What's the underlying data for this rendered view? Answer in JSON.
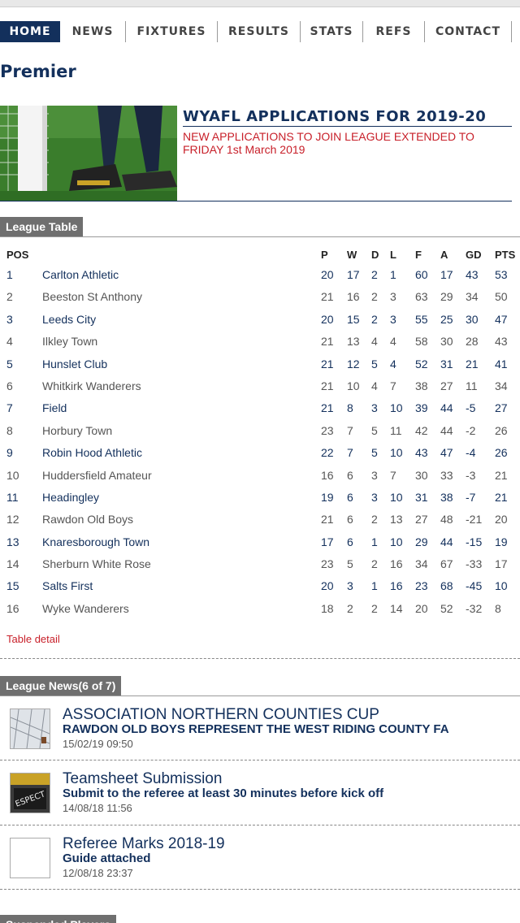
{
  "nav": {
    "items": [
      {
        "label": "HOME",
        "active": true
      },
      {
        "label": "NEWS"
      },
      {
        "label": "FIXTURES"
      },
      {
        "label": "RESULTS"
      },
      {
        "label": "STATS"
      },
      {
        "label": "REFS"
      },
      {
        "label": "CONTACT"
      }
    ]
  },
  "page_title": "Premier",
  "banner": {
    "title": "WYAFL APPLICATIONS FOR 2019-20",
    "subtitle": "NEW APPLICATIONS TO JOIN LEAGUE EXTENDED TO FRIDAY 1st March 2019"
  },
  "league_table": {
    "tab_label": "League Table",
    "headers": [
      "POS",
      "",
      "P",
      "W",
      "D",
      "L",
      "F",
      "A",
      "GD",
      "PTS"
    ],
    "rows": [
      [
        "1",
        "Carlton Athletic",
        "20",
        "17",
        "2",
        "1",
        "60",
        "17",
        "43",
        "53"
      ],
      [
        "2",
        "Beeston St Anthony",
        "21",
        "16",
        "2",
        "3",
        "63",
        "29",
        "34",
        "50"
      ],
      [
        "3",
        "Leeds City",
        "20",
        "15",
        "2",
        "3",
        "55",
        "25",
        "30",
        "47"
      ],
      [
        "4",
        "Ilkley Town",
        "21",
        "13",
        "4",
        "4",
        "58",
        "30",
        "28",
        "43"
      ],
      [
        "5",
        "Hunslet Club",
        "21",
        "12",
        "5",
        "4",
        "52",
        "31",
        "21",
        "41"
      ],
      [
        "6",
        "Whitkirk Wanderers",
        "21",
        "10",
        "4",
        "7",
        "38",
        "27",
        "11",
        "34"
      ],
      [
        "7",
        "Field",
        "21",
        "8",
        "3",
        "10",
        "39",
        "44",
        "-5",
        "27"
      ],
      [
        "8",
        "Horbury Town",
        "23",
        "7",
        "5",
        "11",
        "42",
        "44",
        "-2",
        "26"
      ],
      [
        "9",
        "Robin Hood Athletic",
        "22",
        "7",
        "5",
        "10",
        "43",
        "47",
        "-4",
        "26"
      ],
      [
        "10",
        "Huddersfield Amateur",
        "16",
        "6",
        "3",
        "7",
        "30",
        "33",
        "-3",
        "21"
      ],
      [
        "11",
        "Headingley",
        "19",
        "6",
        "3",
        "10",
        "31",
        "38",
        "-7",
        "21"
      ],
      [
        "12",
        "Rawdon Old Boys",
        "21",
        "6",
        "2",
        "13",
        "27",
        "48",
        "-21",
        "20"
      ],
      [
        "13",
        "Knaresborough Town",
        "17",
        "6",
        "1",
        "10",
        "29",
        "44",
        "-15",
        "19"
      ],
      [
        "14",
        "Sherburn White Rose",
        "23",
        "5",
        "2",
        "16",
        "34",
        "67",
        "-33",
        "17"
      ],
      [
        "15",
        "Salts First",
        "20",
        "3",
        "1",
        "16",
        "23",
        "68",
        "-45",
        "10"
      ],
      [
        "16",
        "Wyke Wanderers",
        "18",
        "2",
        "2",
        "14",
        "20",
        "52",
        "-32",
        "8"
      ]
    ],
    "detail_link": "Table detail"
  },
  "league_news": {
    "tab_label": "League News(6 of 7)",
    "items": [
      {
        "title": "ASSOCIATION NORTHERN COUNTIES CUP",
        "subtitle": "RAWDON OLD BOYS REPRESENT THE WEST RIDING COUNTY FA",
        "date": "15/02/19 09:50",
        "thumb": "goal-net-photo"
      },
      {
        "title": "Teamsheet Submission",
        "subtitle": "Submit to the referee at least 30 minutes before kick off",
        "date": "14/08/18 11:56",
        "thumb": "referee-photo"
      },
      {
        "title": "Referee Marks 2018-19",
        "subtitle": "Guide attached",
        "date": "12/08/18 23:37",
        "thumb": "blank"
      }
    ]
  },
  "next_section": {
    "tab_label": "Suspended Players"
  }
}
